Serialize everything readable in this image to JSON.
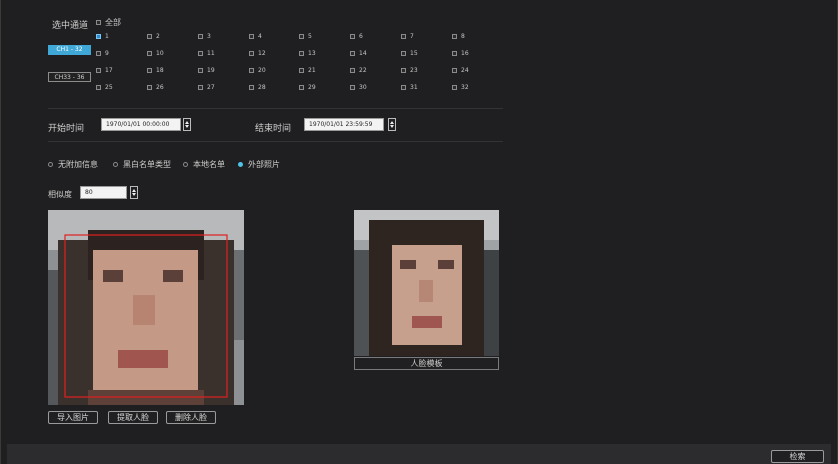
{
  "channels": {
    "label": "选中通道",
    "all_label": "全部",
    "ranges": [
      {
        "label": "CH1 - 32",
        "active": true
      },
      {
        "label": "CH33 - 36",
        "active": false
      }
    ],
    "rows": [
      [
        "1",
        "2",
        "3",
        "4",
        "5",
        "6",
        "7",
        "8"
      ],
      [
        "9",
        "10",
        "11",
        "12",
        "13",
        "14",
        "15",
        "16"
      ],
      [
        "17",
        "18",
        "19",
        "20",
        "21",
        "22",
        "23",
        "24"
      ],
      [
        "25",
        "26",
        "27",
        "28",
        "29",
        "30",
        "31",
        "32"
      ]
    ],
    "checked": [
      "1"
    ]
  },
  "time": {
    "start_label": "开始时间",
    "start_value": "1970/01/01 00:00:00",
    "end_label": "结束时间",
    "end_value": "1970/01/01 23:59:59"
  },
  "filters": {
    "options": [
      "无附加信息",
      "黑白名单类型",
      "本地名单",
      "外部照片"
    ],
    "selected_index": 3
  },
  "similarity": {
    "label": "相似度",
    "value": "80"
  },
  "face_template_label": "人脸模板",
  "buttons": {
    "import_image": "导入图片",
    "extract_face": "提取人脸",
    "delete_face": "删除人脸",
    "search": "检索"
  },
  "colors": {
    "accent": "#3fa8d6",
    "detection_box": "#e02020",
    "background": "#1f1f21"
  }
}
